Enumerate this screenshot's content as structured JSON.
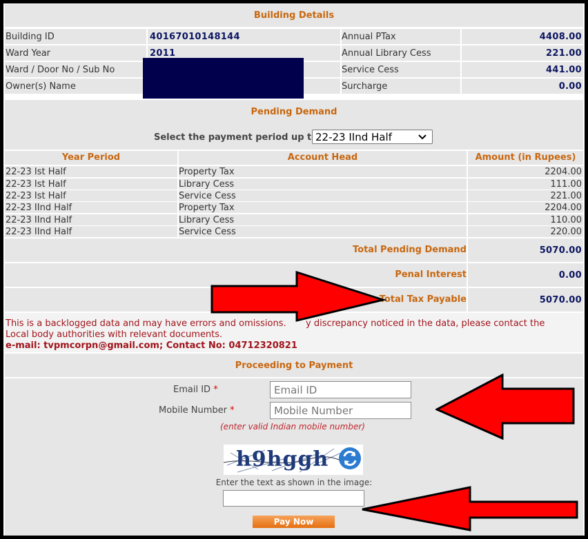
{
  "building": {
    "title": "Building Details",
    "rows": [
      {
        "label": "Building ID",
        "value": "40167010148144",
        "right_label": "Annual PTax",
        "right_value": "4408.00"
      },
      {
        "label": "Ward Year",
        "value": "2011",
        "right_label": "Annual Library Cess",
        "right_value": "221.00"
      },
      {
        "label": "Ward / Door No / Sub No",
        "value": "",
        "right_label": "Service Cess",
        "right_value": "441.00"
      },
      {
        "label": "Owner(s) Name",
        "value": "",
        "right_label": "Surcharge",
        "right_value": "0.00"
      }
    ]
  },
  "pending": {
    "title": "Pending Demand",
    "select_label": "Select the payment period up to",
    "select_value": "22-23 IInd Half",
    "headers": [
      "Year Period",
      "Account Head",
      "Amount (in Rupees)"
    ],
    "rows": [
      [
        "22-23 Ist Half",
        "Property Tax",
        "2204.00"
      ],
      [
        "22-23 Ist Half",
        "Library Cess",
        "111.00"
      ],
      [
        "22-23 Ist Half",
        "Service Cess",
        "221.00"
      ],
      [
        "22-23 IInd Half",
        "Property Tax",
        "2204.00"
      ],
      [
        "22-23 IInd Half",
        "Library Cess",
        "110.00"
      ],
      [
        "22-23 IInd Half",
        "Service Cess",
        "220.00"
      ]
    ],
    "totals": [
      {
        "label": "Total Pending Demand",
        "value": "5070.00"
      },
      {
        "label": "Penal Interest",
        "value": "0.00"
      },
      {
        "label": "Total Tax Payable",
        "value": "5070.00"
      }
    ]
  },
  "notice": {
    "line1": "This is a backlogged data and may have errors and omissions.",
    "line1b": "y discrepancy noticed in the data, please contact the",
    "line2": "Local body authorities with relevant documents.",
    "contact": "e-mail: tvpmcorpn@gmail.com; Contact No: 04712320821"
  },
  "payment": {
    "title": "Proceeding to Payment",
    "email_label": "Email ID",
    "email_placeholder": "Email ID",
    "mobile_label": "Mobile Number",
    "mobile_placeholder": "Mobile Number",
    "required_mark": "*",
    "mobile_hint": "(enter valid Indian mobile number)",
    "captcha_text": "h9hggh",
    "captcha_prompt": "Enter the text as shown in the image:",
    "pay_button": "Pay Now"
  },
  "colors": {
    "header": "#c8670f",
    "value": "#0c1560",
    "notice": "#a0141b",
    "redaction": "#00004d",
    "arrow": "#ff0000"
  }
}
